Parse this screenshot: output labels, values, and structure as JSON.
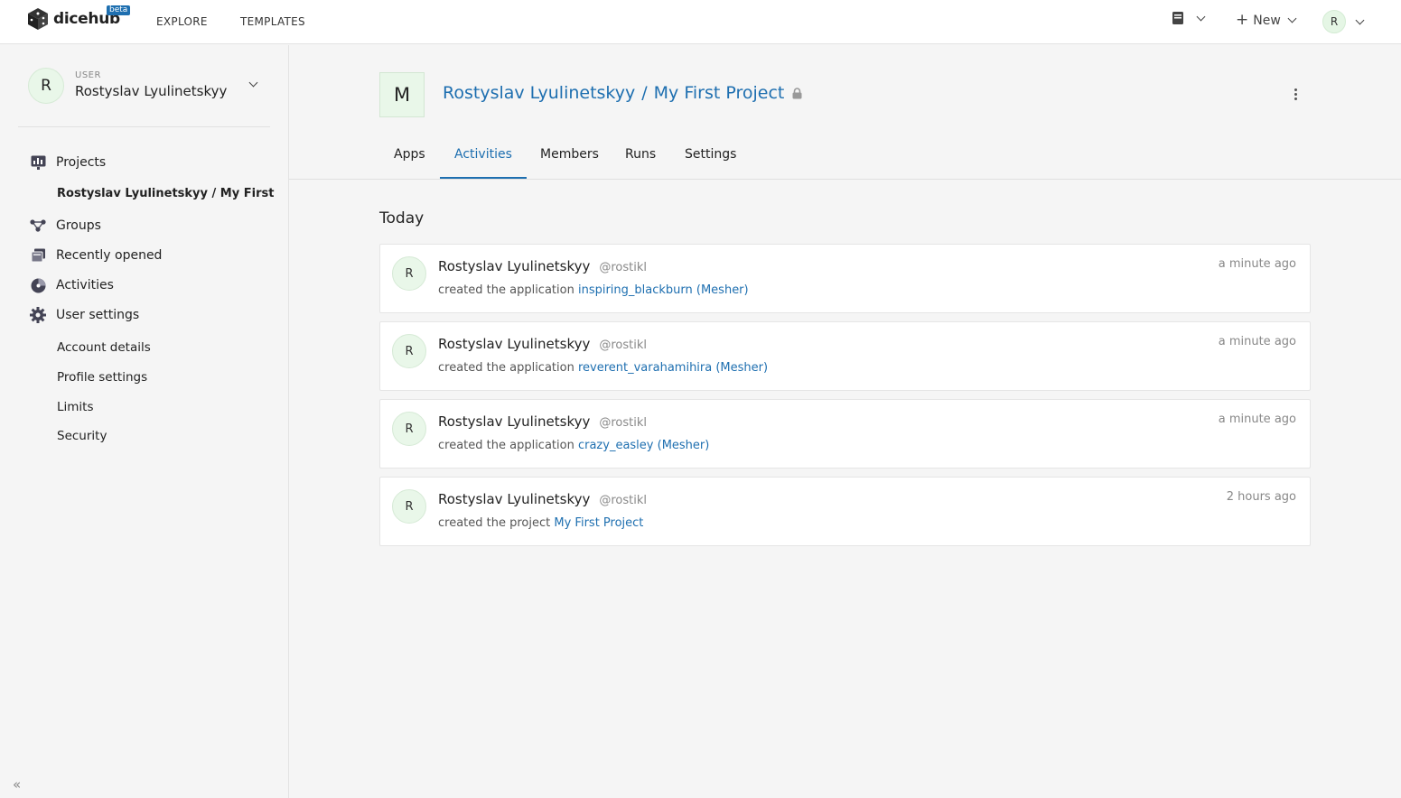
{
  "app": {
    "name": "dicehub",
    "badge": "beta",
    "nav": [
      "EXPLORE",
      "TEMPLATES"
    ],
    "new_label": "New",
    "user_initial": "R"
  },
  "sidebar": {
    "user_role": "USER",
    "user_name": "Rostyslav Lyulinetskyy",
    "user_initial": "R",
    "items": [
      {
        "label": "Projects",
        "icon": "projects-icon"
      },
      {
        "label": "Rostyslav Lyulinetskyy / My First"
      },
      {
        "label": "Groups",
        "icon": "groups-icon"
      },
      {
        "label": "Recently opened",
        "icon": "recent-icon"
      },
      {
        "label": "Activities",
        "icon": "activities-icon"
      },
      {
        "label": "User settings",
        "icon": "gear-icon"
      },
      {
        "label": "Account details"
      },
      {
        "label": "Profile settings"
      },
      {
        "label": "Limits"
      },
      {
        "label": "Security"
      }
    ],
    "collapse": "«"
  },
  "project": {
    "initial": "M",
    "owner": "Rostyslav Lyulinetskyy",
    "separator": "/",
    "name": "My First Project"
  },
  "tabs": [
    {
      "label": "Apps"
    },
    {
      "label": "Activities",
      "active": true
    },
    {
      "label": "Members"
    },
    {
      "label": "Runs"
    },
    {
      "label": "Settings"
    }
  ],
  "section_title": "Today",
  "activities": [
    {
      "initial": "R",
      "name": "Rostyslav Lyulinetskyy",
      "handle": "@rostikl",
      "action": "created the application",
      "target": "inspiring_blackburn (Mesher)",
      "time": "a minute ago"
    },
    {
      "initial": "R",
      "name": "Rostyslav Lyulinetskyy",
      "handle": "@rostikl",
      "action": "created the application",
      "target": "reverent_varahamihira (Mesher)",
      "time": "a minute ago"
    },
    {
      "initial": "R",
      "name": "Rostyslav Lyulinetskyy",
      "handle": "@rostikl",
      "action": "created the application",
      "target": "crazy_easley (Mesher)",
      "time": "a minute ago"
    },
    {
      "initial": "R",
      "name": "Rostyslav Lyulinetskyy",
      "handle": "@rostikl",
      "action": "created the project",
      "target": "My First Project",
      "time": "2 hours ago"
    }
  ],
  "colors": {
    "accent": "#1e6fb0",
    "avatar_bg": "#e9f7e9"
  }
}
